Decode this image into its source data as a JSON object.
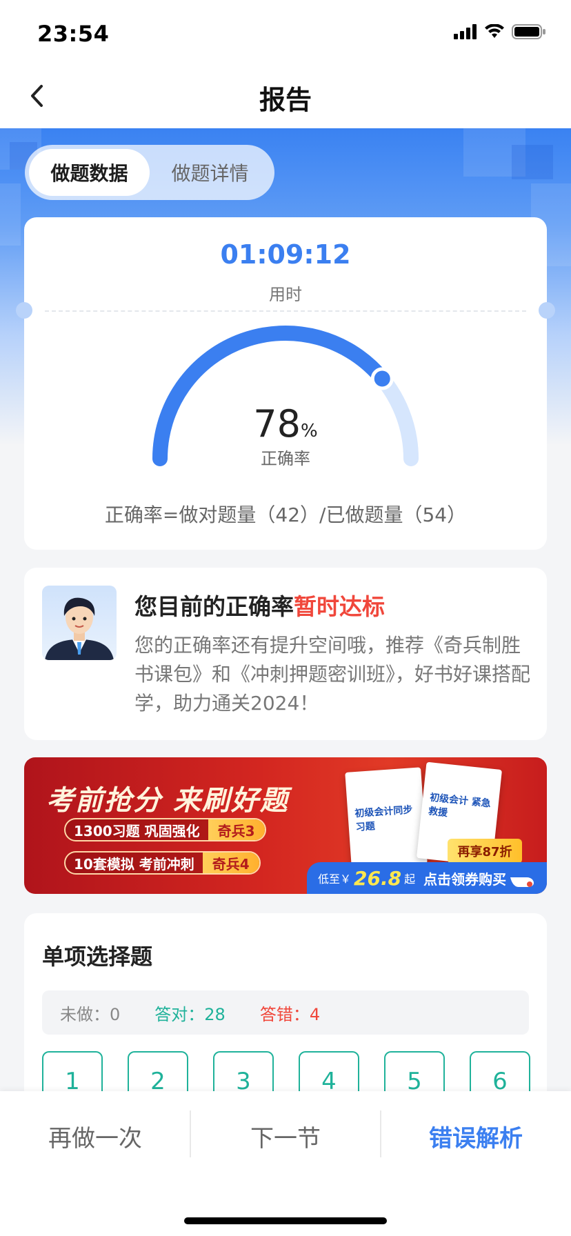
{
  "status": {
    "time": "23:54"
  },
  "nav": {
    "title": "报告"
  },
  "tabs": [
    {
      "label": "做题数据",
      "active": true
    },
    {
      "label": "做题详情",
      "active": false
    }
  ],
  "score": {
    "time": "01:09:12",
    "time_label": "用时",
    "accuracy_value": "78",
    "accuracy_unit": "%",
    "accuracy_fraction": 0.78,
    "accuracy_label": "正确率",
    "formula": "正确率=做对题量（42）/已做题量（54）"
  },
  "advice": {
    "title_prefix": "您目前的正确率",
    "title_highlight": "暂时达标",
    "text": "您的正确率还有提升空间哦，推荐《奇兵制胜书课包》和《冲刺押题密训班》，好书好课搭配学，助力通关2024！"
  },
  "banner": {
    "title": "考前抢分 来刷好题",
    "rows": [
      {
        "text": "1300习题 巩固强化",
        "tag": "奇兵3"
      },
      {
        "text": "10套模拟 考前冲刺",
        "tag": "奇兵4"
      }
    ],
    "book1_text": "初级会计同步习题",
    "book2_text": "初级会计 紧急救援",
    "discount": "再享87折",
    "price_prefix": "低至￥",
    "price": "26.8",
    "price_suffix": "起",
    "cta": "点击领券购买"
  },
  "section": {
    "title": "单项选择题",
    "stats": {
      "undone": "未做：0",
      "correct": "答对：28",
      "wrong": "答错：4"
    },
    "questions": [
      "1",
      "2",
      "3",
      "4",
      "5",
      "6"
    ]
  },
  "bottom": {
    "redo": "再做一次",
    "next": "下一节",
    "analysis": "错误解析"
  },
  "colors": {
    "accent": "#3b7ff0",
    "correct": "#1fb29a",
    "wrong": "#f0473b"
  }
}
